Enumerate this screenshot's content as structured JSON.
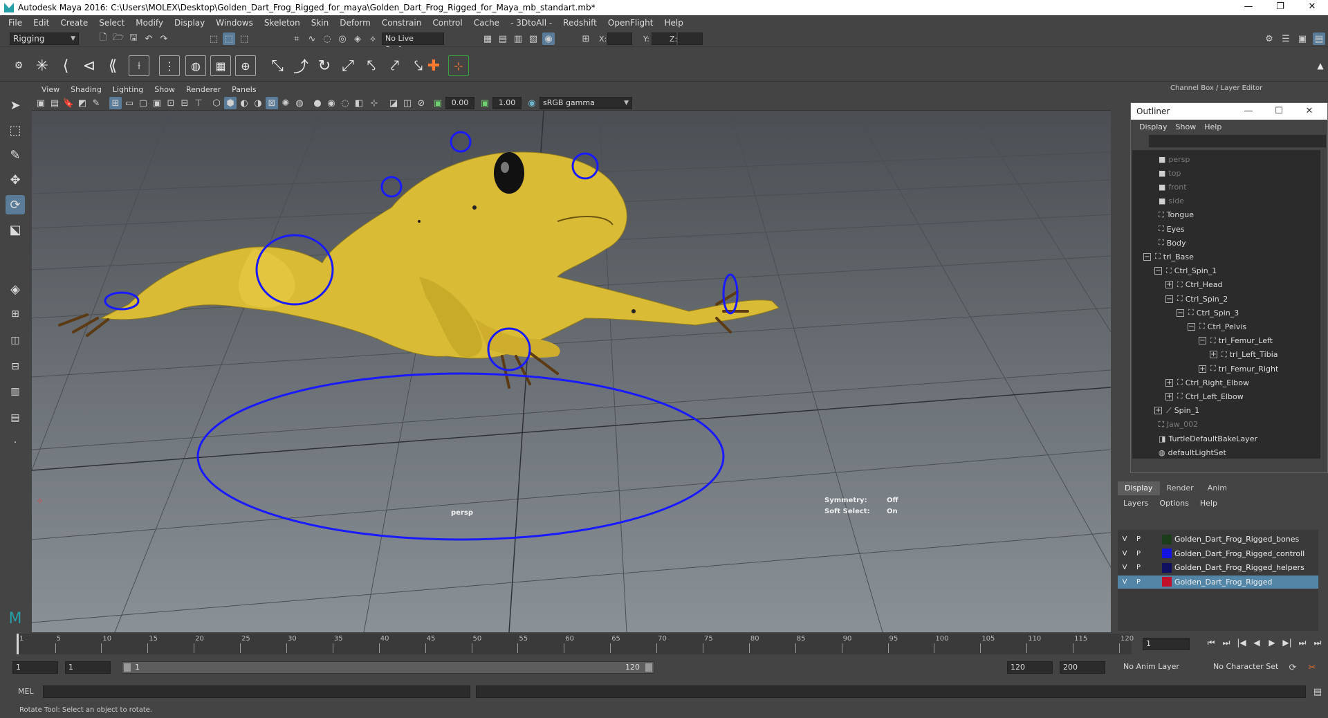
{
  "window": {
    "title": "Autodesk Maya 2016: C:\\Users\\MOLEX\\Desktop\\Golden_Dart_Frog_Rigged_for_maya\\Golden_Dart_Frog_Rigged_for_Maya_mb_standart.mb*",
    "controls": [
      "—",
      "❐",
      "✕"
    ]
  },
  "menubar": [
    "File",
    "Edit",
    "Create",
    "Select",
    "Modify",
    "Display",
    "Windows",
    "Skeleton",
    "Skin",
    "Deform",
    "Constrain",
    "Control",
    "Cache",
    "- 3DtoAll -",
    "Redshift",
    "OpenFlight",
    "Help"
  ],
  "statusline": {
    "menuset": "Rigging",
    "live_surface": "No Live Surface",
    "x_label": "X:",
    "y_label": "Y:",
    "z_label": "Z:"
  },
  "viewport": {
    "menu": [
      "View",
      "Shading",
      "Lighting",
      "Show",
      "Renderer",
      "Panels"
    ],
    "exposure": "0.00",
    "gamma": "1.00",
    "color_space": "sRGB gamma",
    "camera_label": "persp",
    "symmetry_label": "Symmetry:",
    "symmetry_value": "Off",
    "soft_select_label": "Soft Select:",
    "soft_select_value": "On",
    "colors": {
      "frog": "#e0c23a",
      "controls": "#1a1aff"
    }
  },
  "channel_box": {
    "title": "Channel Box / Layer Editor"
  },
  "outliner": {
    "title": "Outliner",
    "menu": [
      "Display",
      "Show",
      "Help"
    ],
    "items": [
      {
        "label": "persp",
        "depth": 0,
        "toggle": "",
        "icon": "camera-icon",
        "dim": true
      },
      {
        "label": "top",
        "depth": 0,
        "toggle": "",
        "icon": "camera-icon",
        "dim": true
      },
      {
        "label": "front",
        "depth": 0,
        "toggle": "",
        "icon": "camera-icon",
        "dim": true
      },
      {
        "label": "side",
        "depth": 0,
        "toggle": "",
        "icon": "camera-icon",
        "dim": true
      },
      {
        "label": "Tongue",
        "depth": 0,
        "toggle": "",
        "icon": "transform-icon",
        "dim": false
      },
      {
        "label": "Eyes",
        "depth": 0,
        "toggle": "",
        "icon": "transform-icon",
        "dim": false
      },
      {
        "label": "Body",
        "depth": 0,
        "toggle": "",
        "icon": "transform-icon",
        "dim": false
      },
      {
        "label": "trl_Base",
        "depth": 0,
        "toggle": "−",
        "icon": "transform-icon",
        "dim": false
      },
      {
        "label": "Ctrl_Spin_1",
        "depth": 1,
        "toggle": "−",
        "icon": "transform-icon",
        "dim": false
      },
      {
        "label": "Ctrl_Head",
        "depth": 2,
        "toggle": "+",
        "icon": "transform-icon",
        "dim": false
      },
      {
        "label": "Ctrl_Spin_2",
        "depth": 2,
        "toggle": "−",
        "icon": "transform-icon",
        "dim": false
      },
      {
        "label": "Ctrl_Spin_3",
        "depth": 3,
        "toggle": "−",
        "icon": "transform-icon",
        "dim": false
      },
      {
        "label": "Ctrl_Pelvis",
        "depth": 4,
        "toggle": "−",
        "icon": "transform-icon",
        "dim": false
      },
      {
        "label": "trl_Femur_Left",
        "depth": 5,
        "toggle": "−",
        "icon": "transform-icon",
        "dim": false
      },
      {
        "label": "trl_Left_Tibia",
        "depth": 6,
        "toggle": "+",
        "icon": "transform-icon",
        "dim": false
      },
      {
        "label": "trl_Femur_Right",
        "depth": 5,
        "toggle": "+",
        "icon": "transform-icon",
        "dim": false
      },
      {
        "label": "Ctrl_Right_Elbow",
        "depth": 2,
        "toggle": "+",
        "icon": "transform-icon",
        "dim": false
      },
      {
        "label": "Ctrl_Left_Elbow",
        "depth": 2,
        "toggle": "+",
        "icon": "transform-icon",
        "dim": false
      },
      {
        "label": "Spin_1",
        "depth": 1,
        "toggle": "+",
        "icon": "joint-icon",
        "dim": false
      },
      {
        "label": "Jaw_002",
        "depth": 0,
        "toggle": "",
        "icon": "transform-icon",
        "dim": true
      },
      {
        "label": "TurtleDefaultBakeLayer",
        "depth": 0,
        "toggle": "",
        "icon": "bake-layer-icon",
        "dim": false
      },
      {
        "label": "defaultLightSet",
        "depth": 0,
        "toggle": "",
        "icon": "set-icon",
        "dim": false
      }
    ]
  },
  "layer_editor": {
    "tabs": [
      "Display",
      "Render",
      "Anim"
    ],
    "menu": [
      "Layers",
      "Options",
      "Help"
    ],
    "layers": [
      {
        "v": "V",
        "p": "P",
        "color": "#1c3d1c",
        "name": "Golden_Dart_Frog_Rigged_bones",
        "selected": false
      },
      {
        "v": "V",
        "p": "P",
        "color": "#1414e0",
        "name": "Golden_Dart_Frog_Rigged_controll",
        "selected": false
      },
      {
        "v": "V",
        "p": "P",
        "color": "#101060",
        "name": "Golden_Dart_Frog_Rigged_helpers",
        "selected": false
      },
      {
        "v": "V",
        "p": "P",
        "color": "#c0102a",
        "name": "Golden_Dart_Frog_Rigged",
        "selected": true
      }
    ]
  },
  "timeline": {
    "ticks": [
      "1",
      "5",
      "10",
      "15",
      "20",
      "25",
      "30",
      "35",
      "40",
      "45",
      "50",
      "55",
      "60",
      "65",
      "70",
      "75",
      "80",
      "85",
      "90",
      "95",
      "100",
      "105",
      "110",
      "115",
      "120"
    ],
    "current_frame": "1",
    "playback_buttons": [
      "⏮",
      "⏭",
      "|◀",
      "◀",
      "▶",
      "▶|",
      "⏭",
      "⏭"
    ]
  },
  "range": {
    "start": "1",
    "playback_start": "1",
    "slider_start": "1",
    "slider_end": "120",
    "playback_end": "120",
    "end": "200",
    "anim_layer": "No Anim Layer",
    "character_set": "No Character Set"
  },
  "command_line": {
    "label": "MEL"
  },
  "help_line": {
    "text": "Rotate Tool: Select an object to rotate."
  }
}
